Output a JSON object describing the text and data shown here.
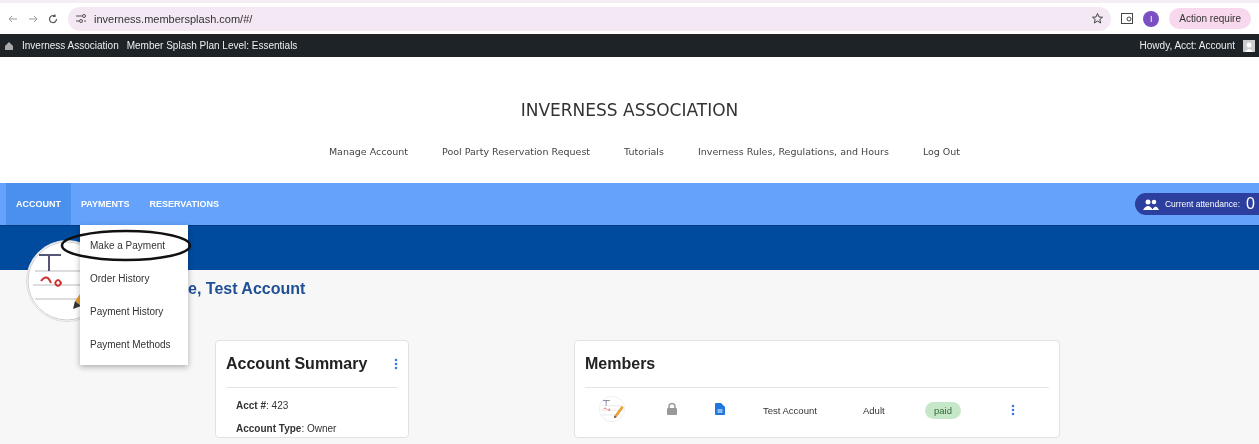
{
  "browser": {
    "url": "inverness.membersplash.com/#/",
    "profile_initial": "I",
    "action_chip": "Action require"
  },
  "admin_bar": {
    "site": "Inverness Association",
    "plan": "Member Splash Plan Level: Essentials",
    "greeting": "Howdy, Acct: Account"
  },
  "header": {
    "title": "INVERNESS ASSOCIATION",
    "links": [
      "Manage Account",
      "Pool Party Reservation Request",
      "Tutorials",
      "Inverness Rules, Regulations, and Hours",
      "Log Out"
    ]
  },
  "nav": {
    "tabs": [
      {
        "label": "ACCOUNT",
        "selected": true
      },
      {
        "label": "PAYMENTS",
        "selected": false
      },
      {
        "label": "RESERVATIONS",
        "selected": false
      }
    ],
    "attendance": {
      "label": "Current attendance:",
      "count": "0"
    }
  },
  "payments_menu": {
    "items": [
      {
        "label": "Make a Payment",
        "circled": true
      },
      {
        "label": "Order History",
        "circled": false
      },
      {
        "label": "Payment History",
        "circled": false
      },
      {
        "label": "Payment Methods",
        "circled": false
      }
    ]
  },
  "welcome": "e, Test Account",
  "account_summary": {
    "title": "Account Summary",
    "fields": [
      "**Acct #**: 423",
      "**Account Type**: Owner"
    ]
  },
  "members": {
    "title": "Members",
    "rows": [
      {
        "name": "Test Account",
        "type": "Adult",
        "status": "paid",
        "locked": true
      }
    ]
  }
}
